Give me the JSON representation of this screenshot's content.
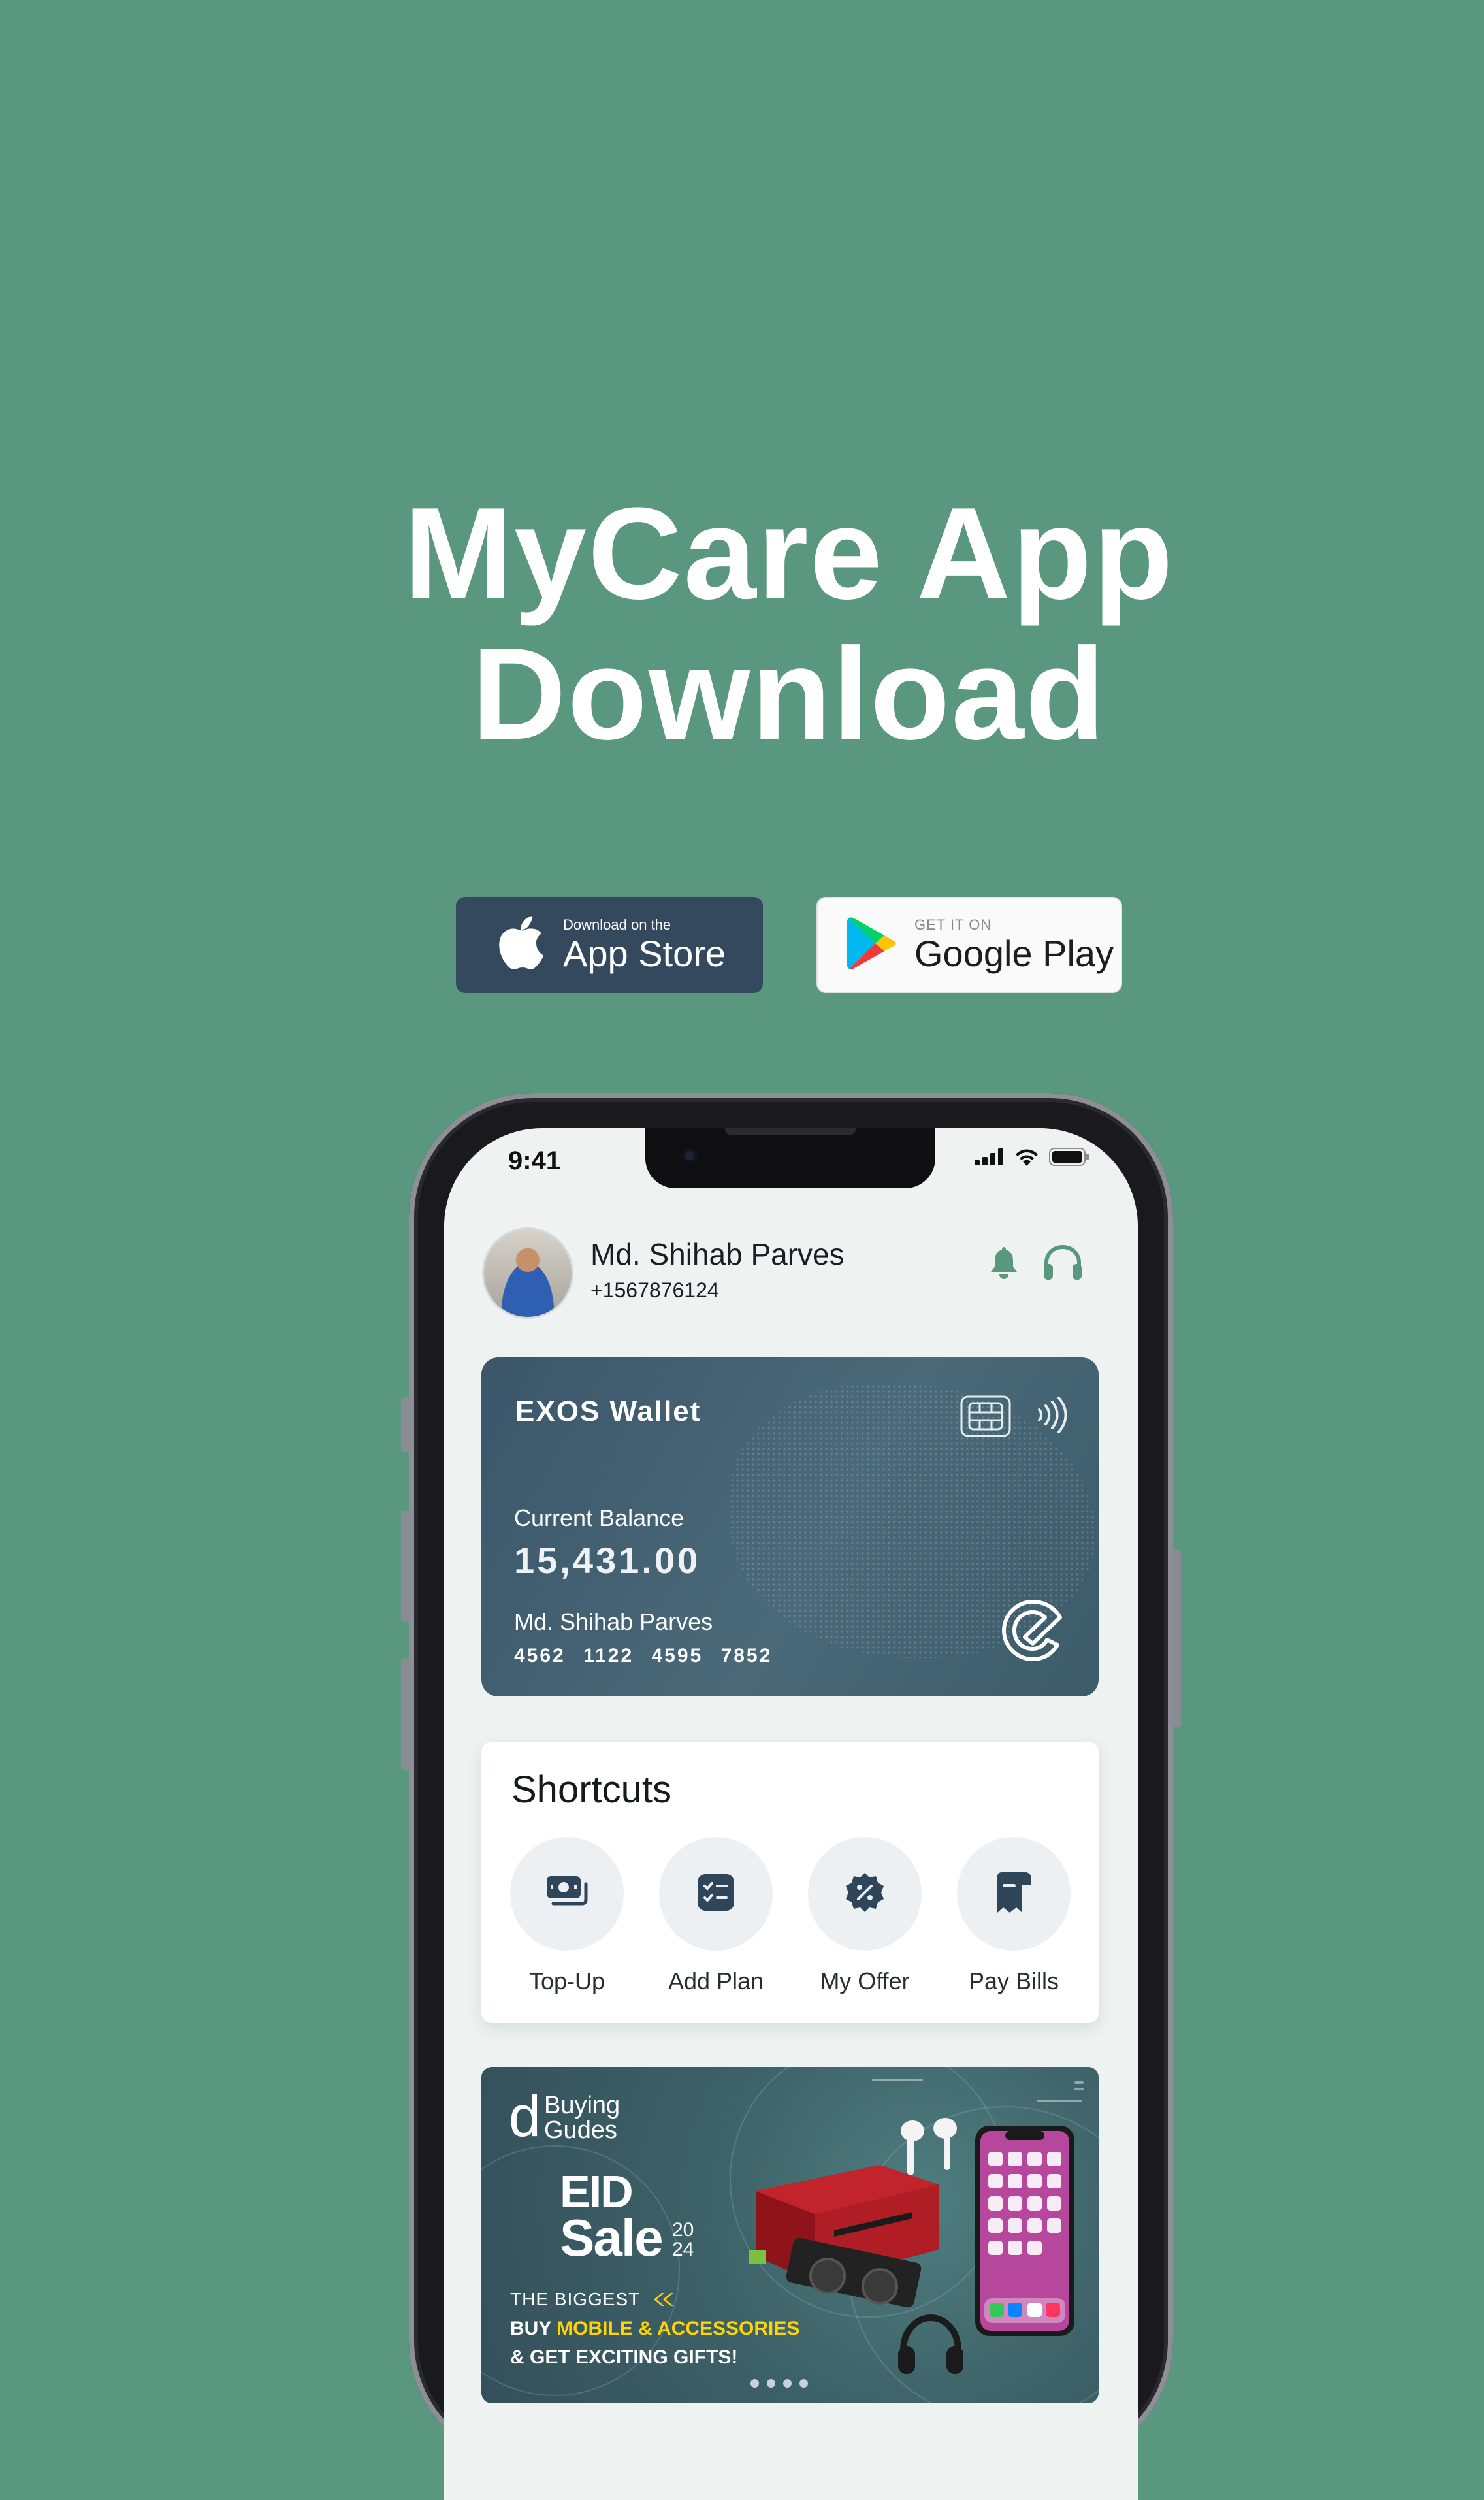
{
  "hero": {
    "line1": "MyCare App",
    "line2": "Download"
  },
  "app_store": {
    "small": "Download on the",
    "big": "App Store"
  },
  "google_play": {
    "small": "GET IT ON",
    "big": "Google Play"
  },
  "status_bar": {
    "time": "9:41"
  },
  "profile": {
    "name": "Md. Shihab Parves",
    "phone": "+1567876124"
  },
  "wallet": {
    "title": "EXOS Wallet",
    "balance_label": "Current Balance",
    "balance": "15,431.00",
    "holder": "Md. Shihab Parves",
    "card_number": "4562 1122 4595 7852"
  },
  "shortcuts": {
    "title": "Shortcuts",
    "items": [
      {
        "label": "Top-Up",
        "icon": "money-stack-icon"
      },
      {
        "label": "Add Plan",
        "icon": "checklist-icon"
      },
      {
        "label": "My Offer",
        "icon": "discount-badge-icon"
      },
      {
        "label": "Pay Bills",
        "icon": "receipt-icon"
      }
    ]
  },
  "banner": {
    "brand_letter": "d",
    "brand_line1": "Buying",
    "brand_line2": "Gudes",
    "eid": "EID",
    "sale": "Sale",
    "year_top": "20",
    "year_bottom": "24",
    "biggest": "THE BIGGEST",
    "line1_prefix": "BUY ",
    "line1_highlight": "MOBILE & ACCESSORIES",
    "line2": "& GET EXCITING GIFTS!",
    "carousel_dots": 4
  },
  "colors": {
    "background": "#5a977f",
    "wallet_card": "#3b566a",
    "store_dark": "#35495e",
    "accent_green": "#5a977f",
    "highlight_yellow": "#ffd400"
  }
}
